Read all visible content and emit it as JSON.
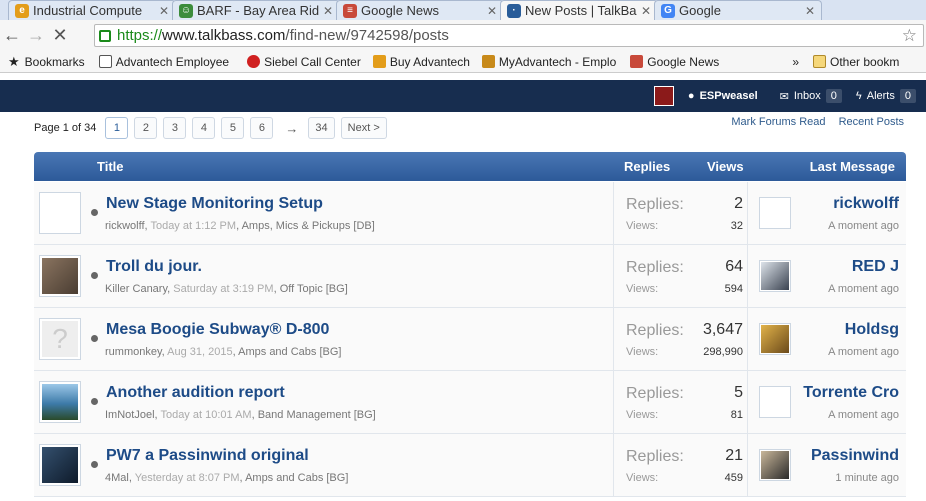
{
  "browser": {
    "tabs": [
      {
        "label": "Industrial Compute",
        "icon": "ie-icon",
        "color": "#e39d1a"
      },
      {
        "label": "BARF - Bay Area Rid",
        "icon": "barf-icon",
        "color": "#3c8c3c"
      },
      {
        "label": "Google News",
        "icon": "news-icon",
        "color": "#c8493a"
      },
      {
        "label": "New Posts | TalkBas",
        "icon": "talkbass-icon",
        "color": "#2a5d99"
      },
      {
        "label": "Google",
        "icon": "google-icon",
        "color": "#4285f4"
      }
    ],
    "url_scheme": "https://",
    "url_host": "www.talkbass.com",
    "url_path": "/find-new/9742598/posts",
    "bookmarks": [
      {
        "label": "Bookmarks",
        "icon": "star-icon"
      },
      {
        "label": "Advantech Employee",
        "icon": "page-icon"
      },
      {
        "label": "Siebel Call Center",
        "icon": "siebel-icon"
      },
      {
        "label": "Buy Advantech",
        "icon": "ie-icon"
      },
      {
        "label": "MyAdvantech - Emplo",
        "icon": "myadv-icon"
      },
      {
        "label": "Google News",
        "icon": "news-icon"
      }
    ],
    "more": "»",
    "other_bookmarks": "Other bookm"
  },
  "site": {
    "username": "ESPweasel",
    "inbox_label": "Inbox",
    "inbox_count": "0",
    "alerts_label": "Alerts",
    "alerts_count": "0"
  },
  "pagination": {
    "label": "Page 1 of 34",
    "pages": [
      "1",
      "2",
      "3",
      "4",
      "5",
      "6"
    ],
    "arrow": "→",
    "last": "34",
    "next": "Next >"
  },
  "links": {
    "mark_read": "Mark Forums Read",
    "recent": "Recent Posts"
  },
  "table": {
    "headers": {
      "title": "Title",
      "replies": "Replies",
      "views": "Views",
      "last": "Last Message"
    },
    "replies_label": "Replies:",
    "views_label": "Views:",
    "rows": [
      {
        "title": "New Stage Monitoring Setup",
        "author": "rickwolff",
        "when": "Today at 1:12 PM",
        "forum": "Amps, Mics & Pickups [DB]",
        "replies": "2",
        "views": "32",
        "last_user": "rickwolff",
        "last_time": "A moment ago",
        "avatar_color": "#ffffff",
        "lavatar_color": "#ffffff"
      },
      {
        "title": "Troll du jour.",
        "author": "Killer Canary",
        "when": "Saturday at 3:19 PM",
        "forum": "Off Topic [BG]",
        "replies": "64",
        "views": "594",
        "last_user": "RED J",
        "last_time": "A moment ago",
        "avatar_color": "#6b5a4a",
        "lavatar_color": "#556070"
      },
      {
        "title": "Mesa Boogie Subway® D-800",
        "author": "rummonkey",
        "when": "Aug 31, 2015",
        "forum": "Amps and Cabs [BG]",
        "replies": "3,647",
        "views": "298,990",
        "last_user": "Holdsg",
        "last_time": "A moment ago",
        "avatar_color": "#eeeeee",
        "lavatar_color": "#b58a2a"
      },
      {
        "title": "Another audition report",
        "author": "ImNotJoel",
        "when": "Today at 10:01 AM",
        "forum": "Band Management [BG]",
        "replies": "5",
        "views": "81",
        "last_user": "Torrente Cro",
        "last_time": "A moment ago",
        "avatar_color": "#3d7aa8",
        "lavatar_color": "#ffffff"
      },
      {
        "title": "PW7 a Passinwind original",
        "author": "4Mal",
        "when": "Yesterday at 8:07 PM",
        "forum": "Amps and Cabs [BG]",
        "replies": "21",
        "views": "459",
        "last_user": "Passinwind",
        "last_time": "1 minute ago",
        "avatar_color": "#1f2f44",
        "lavatar_color": "#5a6470"
      }
    ]
  }
}
